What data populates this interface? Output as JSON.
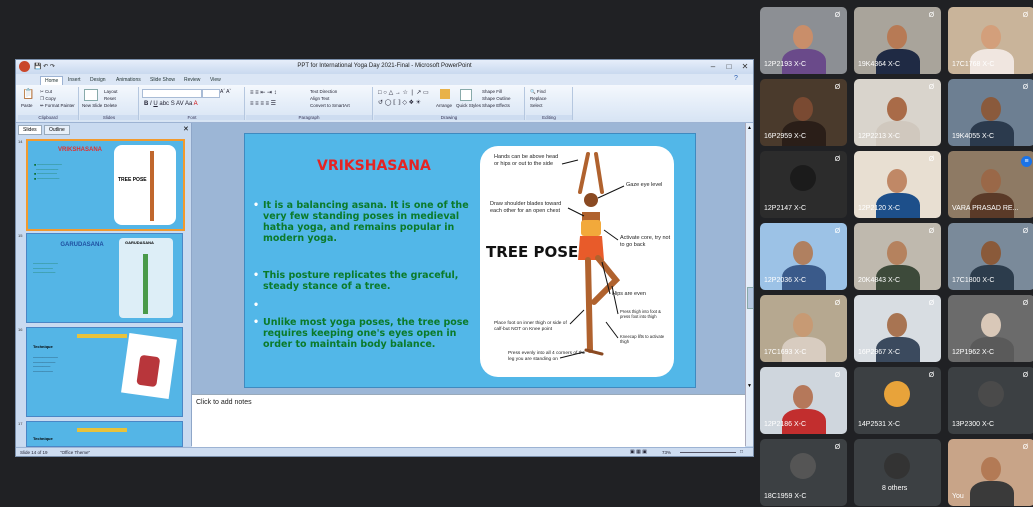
{
  "window": {
    "title": "PPT for International Yoga Day 2021-Final - Microsoft PowerPoint"
  },
  "ribbon": {
    "tabs": [
      "Home",
      "Insert",
      "Design",
      "Animations",
      "Slide Show",
      "Review",
      "View"
    ],
    "clipboard": {
      "paste": "Paste",
      "cut": "Cut",
      "copy": "Copy",
      "format_painter": "Format Painter",
      "label": "Clipboard"
    },
    "slides": {
      "new_slide": "New Slide",
      "layout": "Layout",
      "reset": "Reset",
      "delete": "Delete",
      "label": "Slides"
    },
    "font_label": "Font",
    "paragraph": {
      "text_direction": "Text Direction",
      "align_text": "Align Text",
      "convert_smartart": "Convert to SmartArt",
      "label": "Paragraph"
    },
    "drawing": {
      "arrange": "Arrange",
      "quick_styles": "Quick Styles",
      "shape_fill": "Shape Fill",
      "shape_outline": "Shape Outline",
      "shape_effects": "Shape Effects",
      "label": "Drawing"
    },
    "editing": {
      "find": "Find",
      "replace": "Replace",
      "select": "Select",
      "label": "Editing"
    }
  },
  "panel": {
    "tab_slides": "Slides",
    "tab_outline": "Outline",
    "thumbnails": [
      {
        "number": "14",
        "title": "VRIKSHASANA",
        "selected": true
      },
      {
        "number": "15",
        "title": "GARUDASANA",
        "selected": false
      },
      {
        "number": "16",
        "title": "",
        "selected": false
      },
      {
        "number": "17",
        "title": "",
        "selected": false
      }
    ],
    "thumb2_heading": "GARUDASANA",
    "thumb3_label": "Technique",
    "thumb4_label": "Technique",
    "thumb1_pose": "TREE POSE"
  },
  "slide": {
    "title": "VRIKSHASANA",
    "bullets": [
      "It is a balancing asana. It is one of the very few standing poses in medieval hatha yoga, and remains popular in modern yoga.",
      "This posture replicates the graceful, steady stance of a tree.",
      "",
      "Unlike most yoga poses, the tree pose requires keeping one's eyes open in order to maintain body balance."
    ],
    "pose_title": "TREE POSE",
    "annotations": {
      "hands": "Hands can be above head or hips or out to the side",
      "gaze": "Gaze eye level",
      "shoulders": "Draw shoulder blades toward each other for an open chest",
      "core": "Activate core, try not to go back",
      "hips": "Hips are even",
      "press_thigh": "Press thigh into foot & press foot into thigh",
      "kneecap": "Kneecap lifts to activate thigh",
      "foot": "Place foot on inner thigh or side of calf-but NOT on Knee point",
      "press_evenly": "Press evenly into all 4 corners of the leg you are standing on"
    }
  },
  "notes_placeholder": "Click to add notes",
  "status": {
    "slide_info": "Slide 14 of 19",
    "theme": "\"Office Theme\"",
    "zoom": "73%"
  },
  "colors": {
    "slide_bg": "#52b7e8",
    "title_red": "#e42424",
    "bullet_green": "#0b7a2a",
    "meet_bg": "#202124",
    "speaking_blue": "#1a73e8"
  },
  "participants": [
    {
      "name": "12P2193 X-C",
      "muted": true
    },
    {
      "name": "19K4364 X-C",
      "muted": true
    },
    {
      "name": "17C1768 X-C",
      "muted": true
    },
    {
      "name": "16P2959 X-C",
      "muted": true
    },
    {
      "name": "12P2213 X-C",
      "muted": true
    },
    {
      "name": "19K4055 X-C",
      "muted": true
    },
    {
      "name": "12P2147 X-C",
      "muted": true
    },
    {
      "name": "12P2120 X-C",
      "muted": true
    },
    {
      "name": "VARA PRASAD RE...",
      "muted": false
    },
    {
      "name": "12P2036 X-C",
      "muted": true
    },
    {
      "name": "20K4843 X-C",
      "muted": true
    },
    {
      "name": "17C1800 X-C",
      "muted": true
    },
    {
      "name": "17C1693 X-C",
      "muted": true
    },
    {
      "name": "16P2967 X-C",
      "muted": true
    },
    {
      "name": "12P1962 X-C",
      "muted": true
    },
    {
      "name": "12P2186 X-C",
      "muted": true
    },
    {
      "name": "14P2531 X-C",
      "muted": true
    },
    {
      "name": "13P2300 X-C",
      "muted": true
    },
    {
      "name": "18C1959 X-C",
      "muted": true
    },
    {
      "name": "8 others",
      "muted": false
    },
    {
      "name": "You",
      "muted": true
    }
  ]
}
